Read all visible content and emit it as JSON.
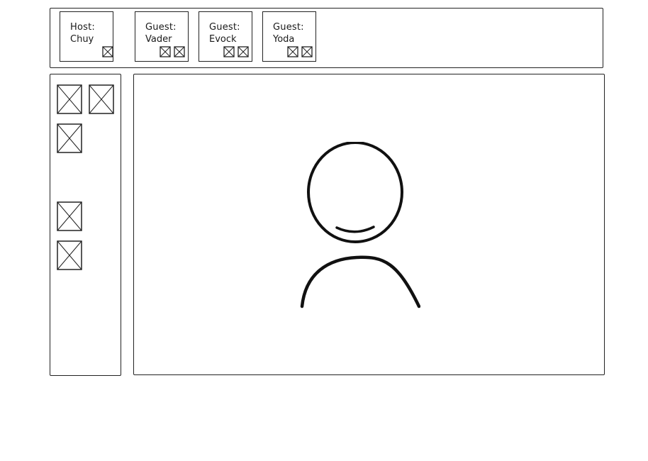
{
  "participants": [
    {
      "role": "Host:",
      "name": "Chuy",
      "controls": [
        "image-placeholder"
      ]
    },
    {
      "role": "Guest:",
      "name": "Vader",
      "controls": [
        "image-placeholder",
        "image-placeholder"
      ]
    },
    {
      "role": "Guest:",
      "name": "Evock",
      "controls": [
        "image-placeholder",
        "image-placeholder"
      ]
    },
    {
      "role": "Guest:",
      "name": "Yoda",
      "controls": [
        "image-placeholder",
        "image-placeholder"
      ]
    }
  ],
  "sidebar": {
    "icons": [
      "image-placeholder",
      "image-placeholder",
      "image-placeholder",
      "image-placeholder",
      "image-placeholder"
    ]
  },
  "stage": {
    "avatar_icon": "user-avatar-icon"
  },
  "colors": {
    "stroke": "#222222",
    "background": "#ffffff"
  }
}
